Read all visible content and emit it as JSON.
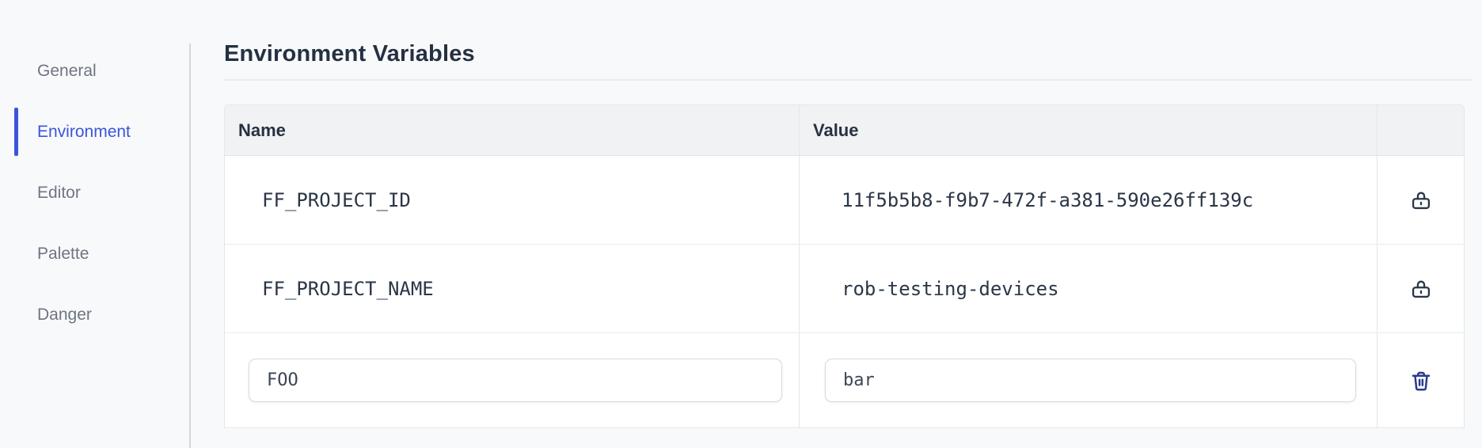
{
  "colors": {
    "accent": "#3b55dc",
    "lock_icon": "#2a3647",
    "trash_icon": "#2c3a8c"
  },
  "sidebar": {
    "items": [
      {
        "label": "General",
        "active": false
      },
      {
        "label": "Environment",
        "active": true
      },
      {
        "label": "Editor",
        "active": false
      },
      {
        "label": "Palette",
        "active": false
      },
      {
        "label": "Danger",
        "active": false
      }
    ]
  },
  "main": {
    "title": "Environment Variables",
    "table": {
      "headers": {
        "name": "Name",
        "value": "Value"
      },
      "rows": [
        {
          "name": "FF_PROJECT_ID",
          "value": "11f5b5b8-f9b7-472f-a381-590e26ff139c",
          "locked": true
        },
        {
          "name": "FF_PROJECT_NAME",
          "value": "rob-testing-devices",
          "locked": true
        }
      ],
      "new_row": {
        "name": "FOO",
        "value": "bar"
      }
    }
  }
}
